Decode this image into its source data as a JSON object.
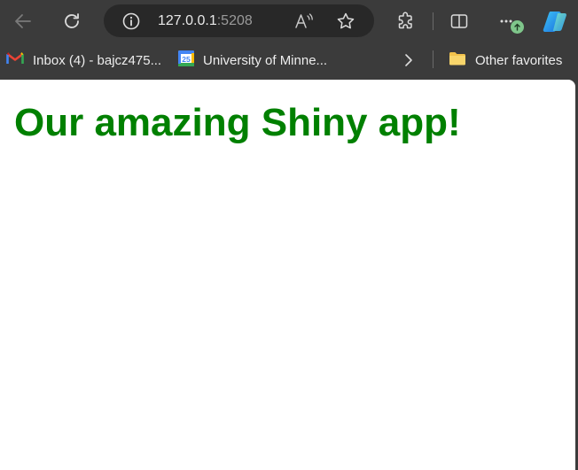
{
  "toolbar": {
    "url_host": "127.0.0.1",
    "url_port": ":5208",
    "icons": [
      "back-icon",
      "reload-icon",
      "info-icon",
      "read-aloud-icon",
      "favorite-star-icon",
      "extensions-icon",
      "split-screen-icon",
      "more-icon",
      "update-arrow-icon",
      "copilot-icon"
    ]
  },
  "bookmarks": {
    "items": [
      {
        "label": "Inbox (4) - bajcz475...",
        "icon": "gmail-icon"
      },
      {
        "label": "University of Minne...",
        "icon": "calendar-icon",
        "icon_text": "25"
      }
    ],
    "other_favorites_label": "Other favorites"
  },
  "page": {
    "title": "Our amazing Shiny app!",
    "title_color": "#008000"
  },
  "colors": {
    "chrome_bg": "#3b3b3b",
    "address_bg": "#282828",
    "page_bg": "#ffffff",
    "badge_green": "#7fc68b"
  }
}
